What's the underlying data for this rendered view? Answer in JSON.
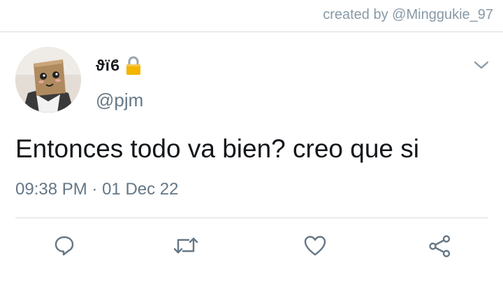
{
  "watermark": {
    "credit_text": "created by @Minggukie_97"
  },
  "tweet": {
    "author": {
      "display_name": "ϑïϐ",
      "handle": "@pjm",
      "protected_icon": "lock-icon",
      "avatar": "box-head-avatar"
    },
    "text": "Entonces todo va bien? creo que si",
    "meta": {
      "time": "09:38 PM",
      "separator": "·",
      "date": "01 Dec 22"
    },
    "menu_icon": "chevron-down-icon",
    "actions": [
      {
        "icon": "reply-icon"
      },
      {
        "icon": "retweet-icon"
      },
      {
        "icon": "like-icon"
      },
      {
        "icon": "share-icon"
      }
    ]
  },
  "colors": {
    "text_primary": "#14171a",
    "text_secondary": "#657786",
    "icon_gray": "#657786",
    "divider": "#d6dde3",
    "lock_gold": "#f4b400"
  }
}
